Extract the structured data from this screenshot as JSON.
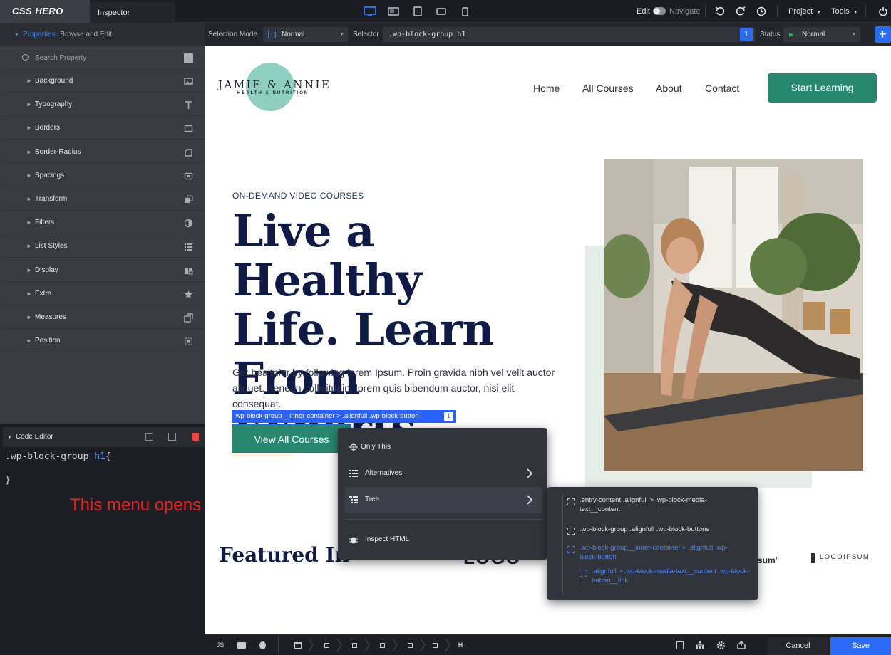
{
  "app": {
    "logo": "CSS HERO",
    "tab": "Inspector"
  },
  "topbar": {
    "edit": "Edit",
    "navigate": "Navigate",
    "project": "Project",
    "tools": "Tools"
  },
  "subbar": {
    "properties_label": "Properties",
    "browse_label": "Browse and Edit",
    "selection_mode_label": "Selection Mode",
    "selection_mode_value": "Normal",
    "selector_label": "Selector",
    "selector_value": ".wp-block-group h1",
    "count": "1",
    "status_label": "Status",
    "status_value": "Normal"
  },
  "sidebar": {
    "search_placeholder": "Search Property",
    "items": [
      {
        "label": "Background",
        "icon": "image-icon"
      },
      {
        "label": "Typography",
        "icon": "type-icon"
      },
      {
        "label": "Borders",
        "icon": "border-icon"
      },
      {
        "label": "Border-Radius",
        "icon": "radius-icon"
      },
      {
        "label": "Spacings",
        "icon": "spacing-icon"
      },
      {
        "label": "Transform",
        "icon": "transform-icon"
      },
      {
        "label": "Filters",
        "icon": "filter-icon"
      },
      {
        "label": "List Styles",
        "icon": "list-icon"
      },
      {
        "label": "Display",
        "icon": "display-icon"
      },
      {
        "label": "Extra",
        "icon": "star-icon"
      },
      {
        "label": "Measures",
        "icon": "measure-icon"
      },
      {
        "label": "Position",
        "icon": "position-icon"
      }
    ]
  },
  "code_editor": {
    "title": "Code Editor",
    "line1_selector": ".wp-block-group ",
    "line1_tag": "h1",
    "line1_brace": "{",
    "line3": "}"
  },
  "annotation": "This menu opens on right-click",
  "site": {
    "logo_text": "JAMIE & ANNIE",
    "logo_sub": "HEALTH & NUTRITION",
    "nav": [
      "Home",
      "All Courses",
      "About",
      "Contact"
    ],
    "cta": "Start Learning",
    "eyebrow": "ON-DEMAND VIDEO COURSES",
    "headline": [
      "Live a Healthy",
      "Life. Learn",
      "From Experts."
    ],
    "paragraph": "Get healthier by following lorem Ipsum. Proin gravida nibh vel velit auctor aliquet. Aenean sollicitudin, lorem quis bibendum auctor, nisi elit consequat.",
    "button": "View All Courses",
    "featured": "Featured In",
    "partner_logo_1": "LOGO",
    "partner_logo_2": "sum'",
    "partner_logo_3": "LOGOIPSUM"
  },
  "selection_badge": {
    "text": ".wp-block-group__inner-container > .alignfull .wp-block-button",
    "count": "1"
  },
  "context_menu": {
    "only_this": "Only This",
    "alternatives": "Alternatives",
    "tree": "Tree",
    "inspect": "Inspect HTML"
  },
  "tree_menu": [
    {
      "text": ".entry-content .alignfull > .wp-block-media-text__content",
      "highlight": false
    },
    {
      "text": ".wp-block-group .alignfull .wp-block-buttons",
      "highlight": false
    },
    {
      "text": ".wp-block-group__inner-container > .alignfull .wp-block-button",
      "highlight": true
    },
    {
      "text": ".alignfull > .wp-block-media-text__content .wp-block-button__link",
      "highlight": true
    }
  ],
  "bottombar": {
    "js": "JS",
    "breadcrumb_last": "H",
    "cancel": "Cancel",
    "save": "Save"
  },
  "colors": {
    "accent": "#2b6cf6",
    "brand_green": "#27876f",
    "navy": "#0f1a47",
    "annotation_red": "#e62420"
  }
}
